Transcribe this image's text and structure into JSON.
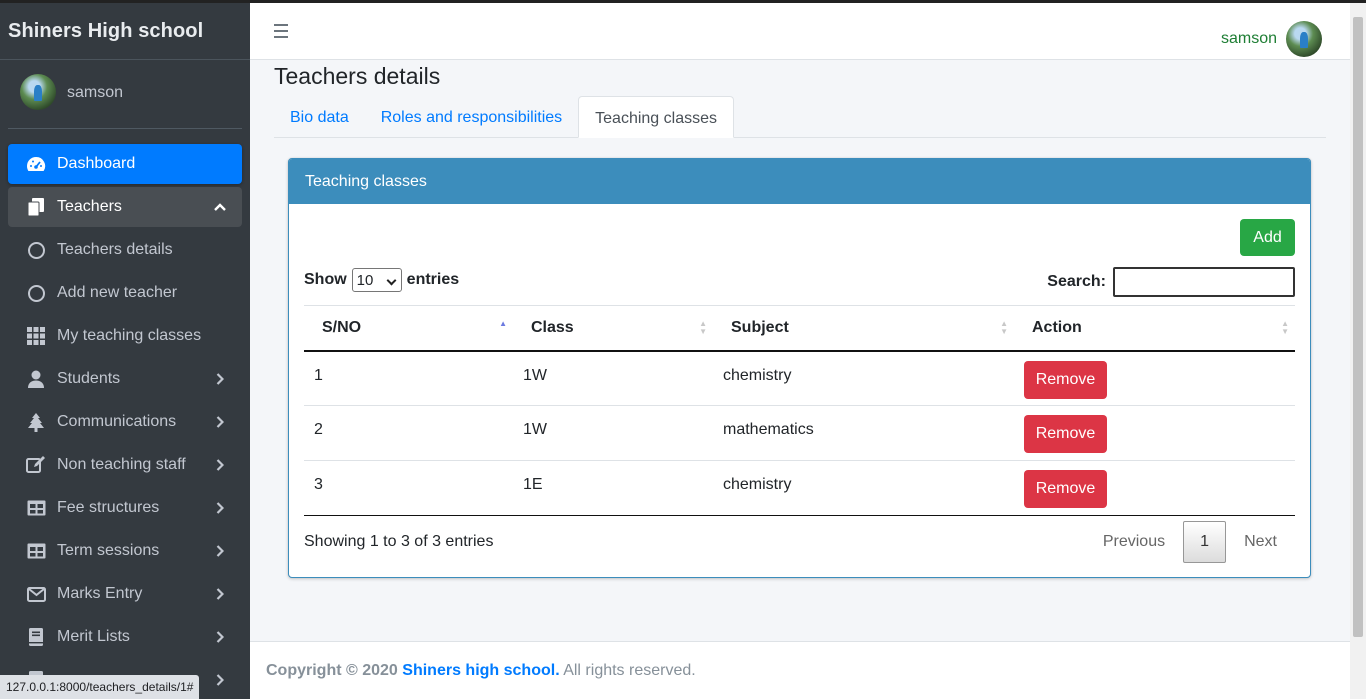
{
  "brand": {
    "title": "Shiners High school"
  },
  "user": {
    "name": "samson"
  },
  "sidebar": {
    "items": [
      {
        "label": "Dashboard",
        "icon": "dashboard-icon"
      },
      {
        "label": "Teachers",
        "icon": "copy-icon"
      },
      {
        "label": "Teachers details",
        "icon": "circle-icon"
      },
      {
        "label": "Add new teacher",
        "icon": "circle-icon"
      },
      {
        "label": "My teaching classes",
        "icon": "grid-icon"
      },
      {
        "label": "Students",
        "icon": "user-icon"
      },
      {
        "label": "Communications",
        "icon": "tree-icon"
      },
      {
        "label": "Non teaching staff",
        "icon": "edit-icon"
      },
      {
        "label": "Fee structures",
        "icon": "table-icon"
      },
      {
        "label": "Term sessions",
        "icon": "table-icon"
      },
      {
        "label": "Marks Entry",
        "icon": "envelope-icon"
      },
      {
        "label": "Merit Lists",
        "icon": "book-icon"
      }
    ]
  },
  "status_url": "127.0.0.1:8000/teachers_details/1#",
  "page": {
    "title": "Teachers details"
  },
  "tabs": [
    {
      "label": "Bio data"
    },
    {
      "label": "Roles and responsibilities"
    },
    {
      "label": "Teaching classes"
    }
  ],
  "card": {
    "title": "Teaching classes",
    "add_label": "Add",
    "show_label": "Show",
    "entries_value": "10",
    "entries_label": "entries",
    "search_label": "Search:",
    "search_value": ""
  },
  "table": {
    "headers": [
      "S/NO",
      "Class",
      "Subject",
      "Action"
    ],
    "rows": [
      {
        "sno": "1",
        "class": "1W",
        "subject": "chemistry",
        "action": "Remove"
      },
      {
        "sno": "2",
        "class": "1W",
        "subject": "mathematics",
        "action": "Remove"
      },
      {
        "sno": "3",
        "class": "1E",
        "subject": "chemistry",
        "action": "Remove"
      }
    ]
  },
  "pagination": {
    "info": "Showing 1 to 3 of 3 entries",
    "previous": "Previous",
    "current": "1",
    "next": "Next"
  },
  "footer": {
    "copyright": "Copyright © 2020",
    "school": "Shiners high school.",
    "rights": "All rights reserved."
  },
  "colors": {
    "sidebar_bg": "#343a40",
    "primary": "#007bff",
    "card_header": "#3c8dbc",
    "success": "#28a745",
    "danger": "#dc3545"
  }
}
